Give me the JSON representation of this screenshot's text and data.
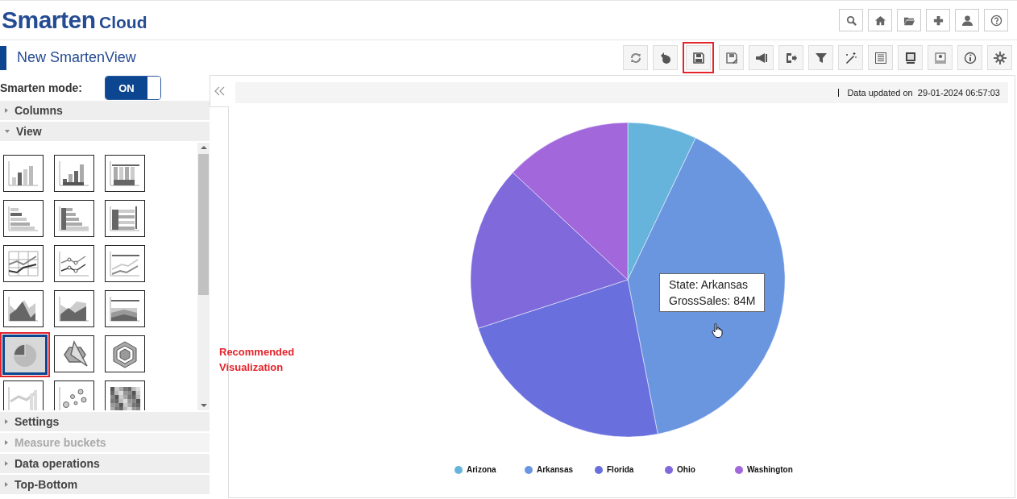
{
  "logo": {
    "brand": "Smarten",
    "product": "Cloud"
  },
  "top_icons": [
    {
      "kind": "search"
    },
    {
      "kind": "home"
    },
    {
      "kind": "folder"
    },
    {
      "kind": "plus"
    },
    {
      "kind": "user"
    },
    {
      "kind": "help"
    }
  ],
  "page_title": "New SmartenView",
  "toolbar": [
    {
      "kind": "refresh",
      "highlighted": false
    },
    {
      "kind": "undo",
      "highlighted": false
    },
    {
      "kind": "save",
      "highlighted": true
    },
    {
      "kind": "save-as",
      "highlighted": false
    },
    {
      "kind": "megaphone",
      "highlighted": false
    },
    {
      "kind": "export",
      "highlighted": false
    },
    {
      "kind": "filter",
      "highlighted": false
    },
    {
      "kind": "wand",
      "highlighted": false
    },
    {
      "kind": "list",
      "highlighted": false
    },
    {
      "kind": "monitor",
      "highlighted": false
    },
    {
      "kind": "presentation",
      "highlighted": false
    },
    {
      "kind": "info",
      "highlighted": false
    },
    {
      "kind": "gear",
      "highlighted": false
    }
  ],
  "smarten_mode": {
    "label": "Smarten mode:",
    "value": "ON",
    "on": true
  },
  "sidebar": {
    "sections": [
      {
        "label": "Columns",
        "expanded": false,
        "disabled": false
      },
      {
        "label": "View",
        "expanded": true,
        "disabled": false,
        "chart_types": [
          {
            "kind": "column",
            "selected": false
          },
          {
            "kind": "stacked-column",
            "selected": false
          },
          {
            "kind": "percent-column",
            "selected": false
          },
          {
            "kind": "bar",
            "selected": false
          },
          {
            "kind": "stacked-bar",
            "selected": false
          },
          {
            "kind": "percent-bar",
            "selected": false
          },
          {
            "kind": "line",
            "selected": false
          },
          {
            "kind": "line-markers",
            "selected": false
          },
          {
            "kind": "percent-line",
            "selected": false
          },
          {
            "kind": "area",
            "selected": false
          },
          {
            "kind": "stacked-area",
            "selected": false
          },
          {
            "kind": "percent-area",
            "selected": false
          },
          {
            "kind": "pie",
            "selected": true,
            "recommended": true
          },
          {
            "kind": "radar",
            "selected": false
          },
          {
            "kind": "polar",
            "selected": false
          },
          {
            "kind": "combo",
            "selected": false
          },
          {
            "kind": "bubble",
            "selected": false
          },
          {
            "kind": "heatmap",
            "selected": false
          }
        ]
      },
      {
        "label": "Settings",
        "expanded": false,
        "disabled": false
      },
      {
        "label": "Measure buckets",
        "expanded": false,
        "disabled": true
      },
      {
        "label": "Data operations",
        "expanded": false,
        "disabled": false
      },
      {
        "label": "Top-Bottom",
        "expanded": false,
        "disabled": false
      }
    ]
  },
  "recommended_note": "Recommended Visualization",
  "info_bar": {
    "label": "Data updated on",
    "timestamp": "29-01-2024 06:57:03"
  },
  "legend": [
    {
      "name": "Arizona",
      "color": "#66b4dc"
    },
    {
      "name": "Arkansas",
      "color": "#6a96e0"
    },
    {
      "name": "Florida",
      "color": "#6970dd"
    },
    {
      "name": "Ohio",
      "color": "#7f69db"
    },
    {
      "name": "Washington",
      "color": "#a167db"
    }
  ],
  "tooltip": {
    "lines": [
      "State: Arkansas",
      "GrossSales: 84M"
    ]
  }
}
